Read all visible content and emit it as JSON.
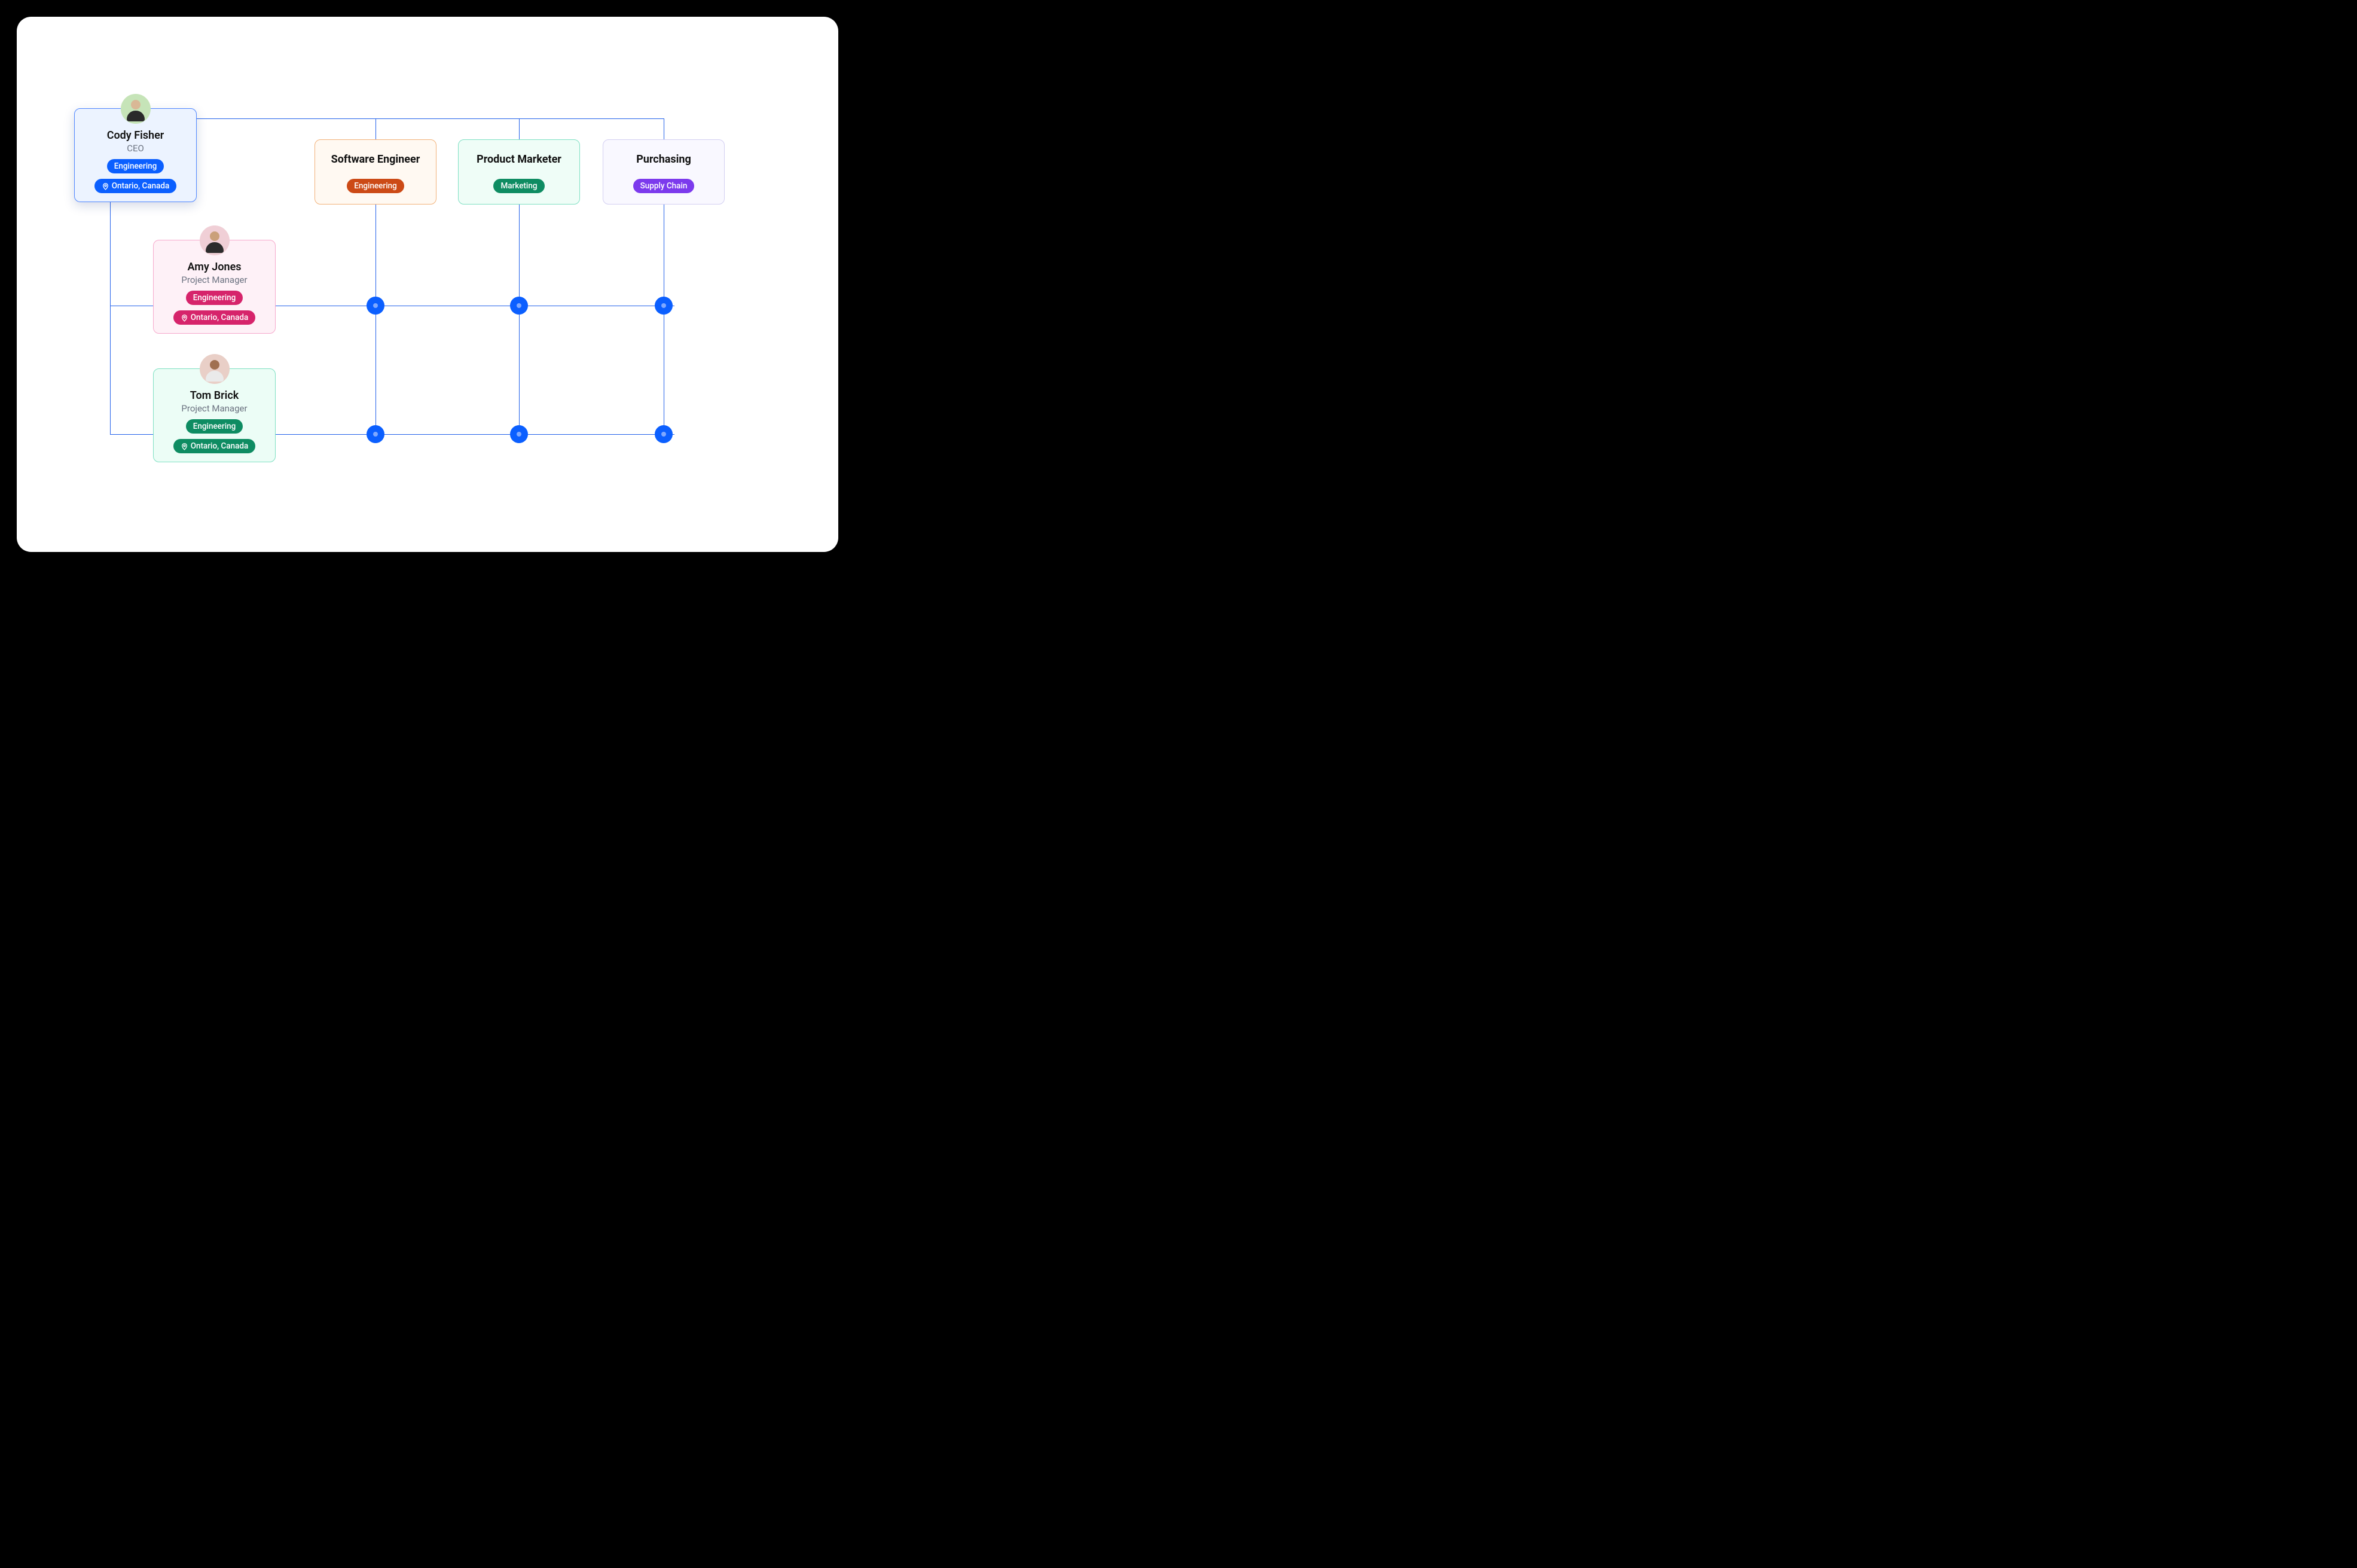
{
  "people": {
    "ceo": {
      "name": "Cody Fisher",
      "role": "CEO",
      "dept": "Engineering",
      "location": "Ontario, Canada"
    },
    "pm1": {
      "name": "Amy Jones",
      "role": "Project Manager",
      "dept": "Engineering",
      "location": "Ontario, Canada"
    },
    "pm2": {
      "name": "Tom Brick",
      "role": "Project Manager",
      "dept": "Engineering",
      "location": "Ontario, Canada"
    }
  },
  "roles": {
    "swe": {
      "title": "Software Engineer",
      "tag": "Engineering"
    },
    "pmk": {
      "title": "Product Marketer",
      "tag": "Marketing"
    },
    "pur": {
      "title": "Purchasing",
      "tag": "Supply Chain"
    }
  },
  "colors": {
    "line": "#2463eb",
    "node": "#0b5fff",
    "ceo_border": "#4f86ff",
    "ceo_bg": "#ecf3ff",
    "ceo_pill": "#0b5fff",
    "pm1_border": "#f6a9cc",
    "pm1_bg": "#fef1f7",
    "pm1_pill": "#d6246b",
    "pm2_border": "#7fe0c3",
    "pm2_bg": "#ecfdf6",
    "pm2_pill": "#0e8c62",
    "swe_border": "#f2b27a",
    "swe_bg": "#fff9f2",
    "swe_pill": "#cc4a16",
    "pmk_border": "#7fe0c3",
    "pmk_bg": "#effdf7",
    "pmk_pill": "#0e8c62",
    "pur_border": "#d3cff2",
    "pur_bg": "#f9f8ff",
    "pur_pill": "#7c3aed"
  }
}
